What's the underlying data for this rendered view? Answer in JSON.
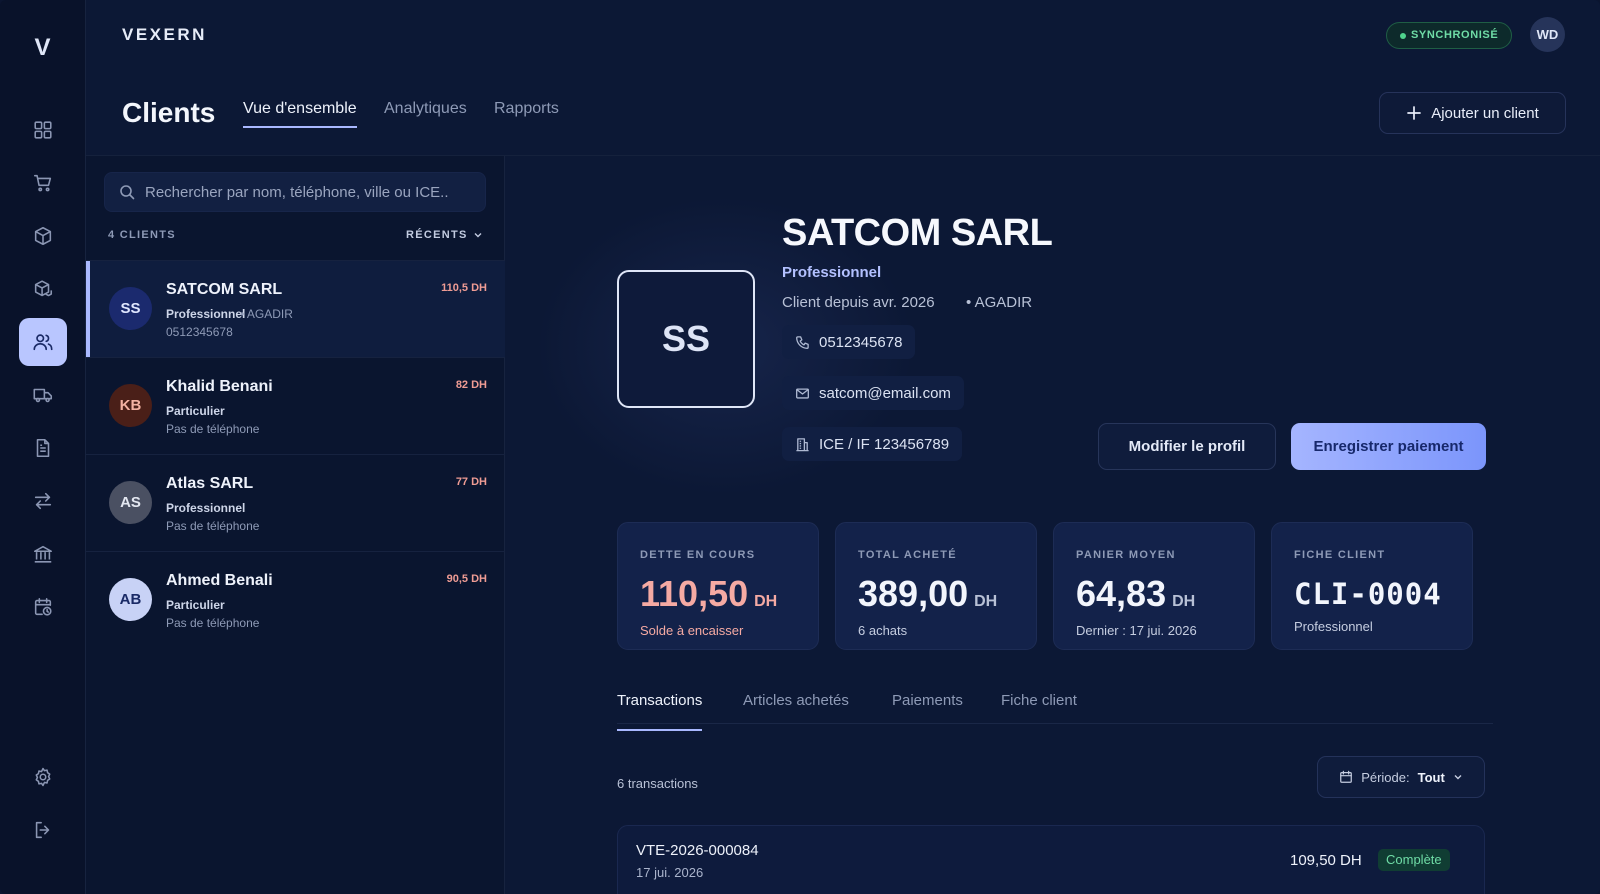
{
  "app": {
    "logo": "V",
    "brand": "VEXERN",
    "sync_status": "SYNCHRONISÉ",
    "user_initials": "WD"
  },
  "rail": [
    "dashboard-icon",
    "cart-icon",
    "box-icon",
    "boxes-icon",
    "users-icon",
    "truck-icon",
    "document-icon",
    "transfer-icon",
    "bank-icon",
    "calendar-clock-icon",
    "gear-icon",
    "logout-icon"
  ],
  "page": {
    "title": "Clients",
    "tabs": [
      "Vue d'ensemble",
      "Analytiques",
      "Rapports"
    ],
    "add_button": "Ajouter un client"
  },
  "list": {
    "search_placeholder": "Rechercher par nom, téléphone, ville ou ICE..",
    "count_label": "4 CLIENTS",
    "sort_label": "RÉCENTS",
    "clients": [
      {
        "initials": "SS",
        "name": "SATCOM SARL",
        "type": "Professionnel",
        "city": "• AGADIR",
        "phone": "0512345678",
        "amount": "110,5 DH"
      },
      {
        "initials": "KB",
        "name": "Khalid Benani",
        "type": "Particulier",
        "city": "",
        "phone": "Pas de téléphone",
        "amount": "82 DH"
      },
      {
        "initials": "AS",
        "name": "Atlas SARL",
        "type": "Professionnel",
        "city": "",
        "phone": "Pas de téléphone",
        "amount": "77 DH"
      },
      {
        "initials": "AB",
        "name": "Ahmed Benali",
        "type": "Particulier",
        "city": "",
        "phone": "Pas de téléphone",
        "amount": "90,5 DH"
      }
    ]
  },
  "detail": {
    "initials": "SS",
    "name": "SATCOM SARL",
    "type": "Professionnel",
    "since": "Client depuis avr. 2026",
    "city": "• AGADIR",
    "phone": "0512345678",
    "email": "satcom@email.com",
    "ice": "ICE / IF 123456789",
    "edit_button": "Modifier le profil",
    "pay_button": "Enregistrer paiement",
    "stats": [
      {
        "label": "DETTE EN COURS",
        "value": "110,50",
        "unit": "DH",
        "sub": "Solde à encaisser"
      },
      {
        "label": "TOTAL ACHETÉ",
        "value": "389,00",
        "unit": "DH",
        "sub": "6 achats"
      },
      {
        "label": "PANIER MOYEN",
        "value": "64,83",
        "unit": "DH",
        "sub": "Dernier : 17 jui. 2026"
      },
      {
        "label": "FICHE CLIENT",
        "value": "CLI-0004",
        "sub": "Professionnel"
      }
    ],
    "tabs": [
      "Transactions",
      "Articles achetés",
      "Paiements",
      "Fiche client"
    ],
    "tx_count": "6 transactions",
    "period_label": "Période:",
    "period_value": "Tout",
    "transactions": [
      {
        "ref": "VTE-2026-000084",
        "date": "17 jui. 2026",
        "amount": "109,50 DH",
        "status": "Complète"
      }
    ]
  },
  "colors": {
    "accent": "#a9b8ff",
    "debt": "#f5aaa3",
    "success": "#6fdca6",
    "background": "#0c1835"
  }
}
